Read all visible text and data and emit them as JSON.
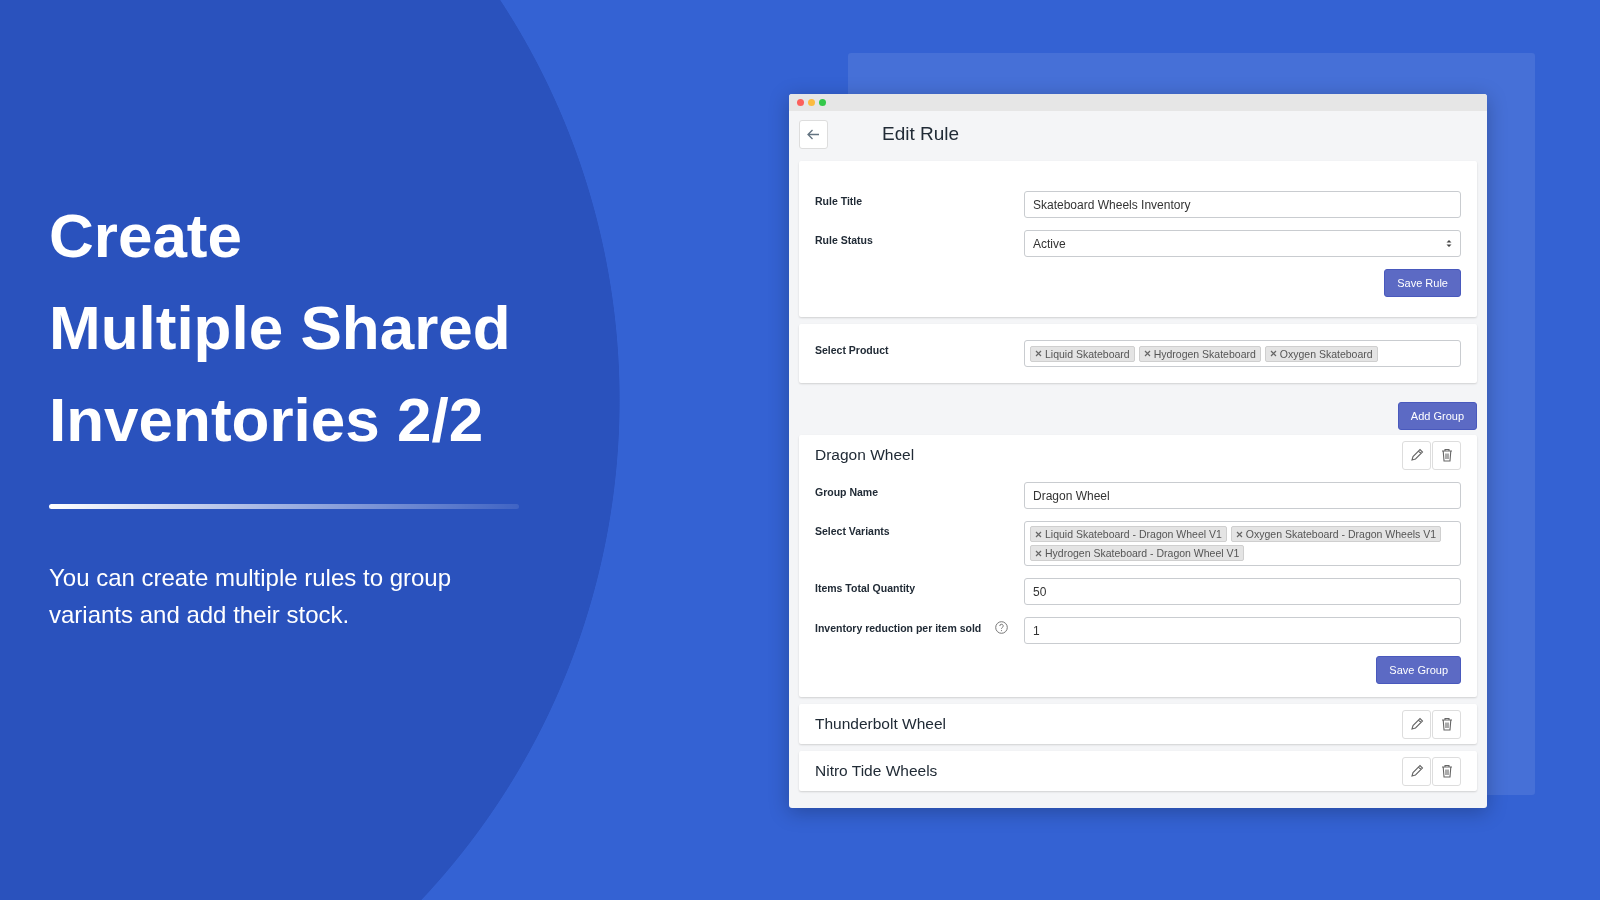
{
  "hero": {
    "title_lines": [
      "Create",
      "Multiple Shared",
      "Inventories 2/2"
    ],
    "description": "You can create multiple rules to group variants and add their stock."
  },
  "window": {
    "title": "Edit Rule",
    "rule_form": {
      "fields": [
        {
          "kind": "text",
          "label": "Rule Title",
          "value": "Skateboard Wheels Inventory"
        },
        {
          "kind": "select",
          "label": "Rule Status",
          "value": "Active"
        }
      ],
      "save_button": "Save Rule"
    },
    "product_selector": {
      "label": "Select Product",
      "tags": [
        "Liquid Skateboard",
        "Hydrogen Skateboard",
        "Oxygen Skateboard"
      ]
    },
    "add_group_button": "Add Group",
    "groups": [
      {
        "name": "Dragon Wheel",
        "expanded": true,
        "fields": [
          {
            "kind": "text",
            "label": "Group Name",
            "value": "Dragon Wheel"
          },
          {
            "kind": "tags",
            "label": "Select Variants",
            "tags": [
              "Liquid Skateboard - Dragon Wheel V1",
              "Oxygen Skateboard - Dragon Wheels V1",
              "Hydrogen Skateboard - Dragon Wheel V1"
            ]
          },
          {
            "kind": "text",
            "label": "Items Total Quantity",
            "value": "50"
          },
          {
            "kind": "text",
            "label": "Inventory reduction per item sold",
            "value": "1",
            "help": true
          }
        ],
        "save_button": "Save Group"
      },
      {
        "name": "Thunderbolt Wheel",
        "expanded": false
      },
      {
        "name": "Nitro Tide Wheels",
        "expanded": false
      }
    ]
  }
}
